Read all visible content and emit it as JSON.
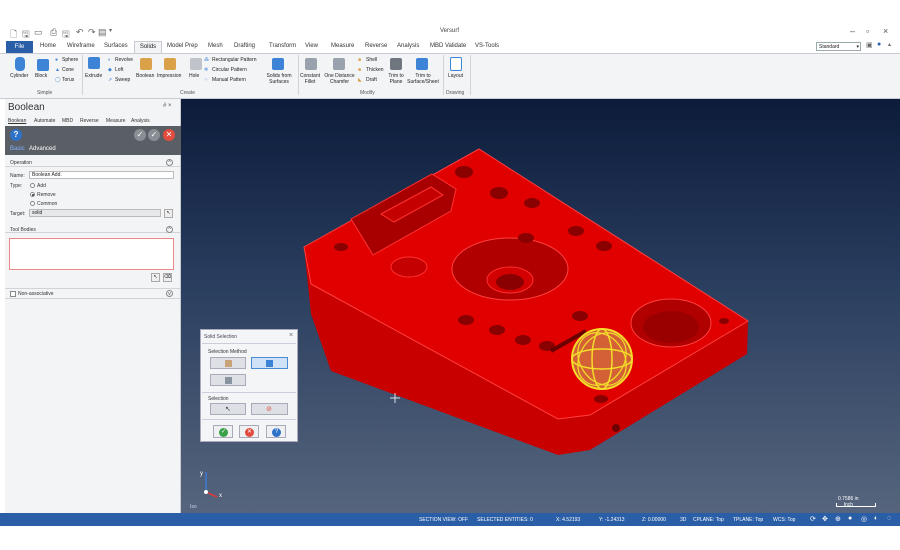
{
  "app_title": "Versurf",
  "menu_tabs": [
    "File",
    "Home",
    "Wireframe",
    "Surfaces",
    "Solids",
    "Model Prep",
    "Mesh",
    "Drafting",
    "Transform",
    "View",
    "Measure",
    "Reverse",
    "Analysis",
    "MBD Validate",
    "VS-Tools"
  ],
  "view_select": "Standard",
  "ribbon": {
    "simple": {
      "group": "Simple",
      "items": [
        "Cylinder",
        "Block",
        "Sphere",
        "Cone",
        "Torus"
      ]
    },
    "create": {
      "group": "Create",
      "items": [
        "Extrude",
        "Revolve",
        "Loft",
        "Sweep",
        "Boolean",
        "Impression",
        "Hole",
        "Rectangular Pattern",
        "Circular Pattern",
        "Manual Pattern",
        "Solids from Surfaces"
      ]
    },
    "modify": {
      "group": "Modify",
      "items": [
        "Constant Fillet",
        "One Distance Chamfer",
        "Shell",
        "Thicken",
        "Draft",
        "Trim to Plane",
        "Trim to Surface/Sheet"
      ]
    },
    "drawing": {
      "group": "Drawing",
      "items": [
        "Layout"
      ]
    }
  },
  "panel": {
    "title": "Boolean",
    "pin": "# ×",
    "tabs": [
      "Boolean",
      "Automate",
      "MBD",
      "Reverse",
      "Measure",
      "Analysis"
    ],
    "subtabs": [
      "Basic",
      "Advanced"
    ],
    "operation_header": "Operation",
    "name_label": "Name:",
    "name_value": "Boolean Add.",
    "type_label": "Type:",
    "types": [
      "Add",
      "Remove",
      "Common"
    ],
    "selected_type": "Remove",
    "target_label": "Target:",
    "target_value": "solid",
    "tool_bodies_header": "Tool Bodies",
    "non_associative": "Non-associative"
  },
  "dialog": {
    "title": "Solid Selection",
    "method_header": "Selection Method",
    "selection_header": "Selection"
  },
  "status": {
    "section_view": "SECTION VIEW: OFF",
    "selected": "SELECTED ENTITIES: 0",
    "x": "X: 4.52193",
    "y": "Y: -1.24313",
    "z": "Z: 0.00000",
    "mode": "3D",
    "cplane": "CPLANE: Top",
    "tplane": "TPLANE: Top",
    "wcs": "WCS: Top"
  },
  "scale": {
    "value": "0.7586 in",
    "unit": "Inch"
  },
  "viewport_label": "Iso",
  "axes": [
    "y",
    "x"
  ],
  "colors": {
    "accent": "#2a5ea6",
    "part": "#e00000",
    "highlight": "#f5dd2a"
  }
}
